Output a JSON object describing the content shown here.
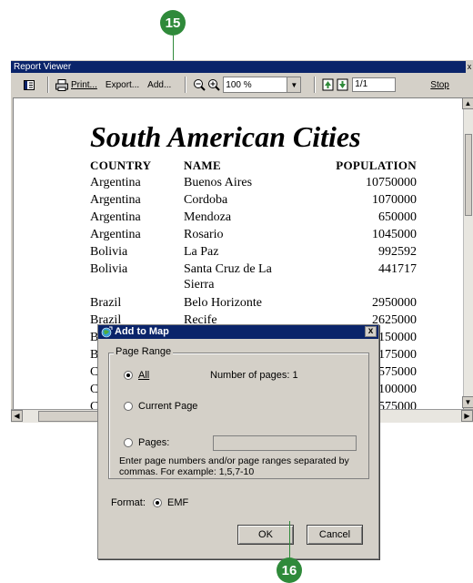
{
  "callouts": {
    "top": "15",
    "bottom": "16"
  },
  "window": {
    "title": "Report Viewer",
    "close_glyph": "x"
  },
  "toolbar": {
    "print_label": "Print...",
    "export_label": "Export...",
    "add_label": "Add...",
    "zoom_value": "100 %",
    "page_value": "1/1",
    "stop_label": "Stop"
  },
  "icons": {
    "toc": "table-of-contents-icon",
    "printer": "printer-icon",
    "zoom_out": "zoom-out-icon",
    "zoom_in": "zoom-in-icon",
    "page_up": "previous-page-icon",
    "page_down": "next-page-icon"
  },
  "report": {
    "title": "South American Cities",
    "columns": [
      "COUNTRY",
      "NAME",
      "POPULATION"
    ],
    "rows": [
      [
        "Argentina",
        "Buenos Aires",
        "10750000"
      ],
      [
        "Argentina",
        "Cordoba",
        "1070000"
      ],
      [
        "Argentina",
        "Mendoza",
        "650000"
      ],
      [
        "Argentina",
        "Rosario",
        "1045000"
      ],
      [
        "Bolivia",
        "La Paz",
        "992592"
      ],
      [
        "Bolivia",
        "Santa Cruz de La Sierra",
        "441717"
      ],
      [
        "Brazil",
        "Belo Horizonte",
        "2950000"
      ],
      [
        "Brazil",
        "Recife",
        "2625000"
      ],
      [
        "B",
        "",
        "150000"
      ],
      [
        "B",
        "",
        "175000"
      ],
      [
        "C",
        "",
        "575000"
      ],
      [
        "C",
        "",
        "100000"
      ],
      [
        "C",
        "",
        "575000"
      ]
    ]
  },
  "dialog": {
    "title": "Add to Map",
    "close_glyph": "x",
    "group_label": "Page Range",
    "radio_all": "All",
    "pages_count": "Number of pages:  1",
    "radio_current": "Current Page",
    "radio_pages": "Pages:",
    "help_text": "Enter page numbers and/or page ranges separated by commas. For example: 1,5,7-10",
    "format_label": "Format:",
    "format_value": "EMF",
    "ok_label": "OK",
    "cancel_label": "Cancel"
  },
  "colors": {
    "titlebar": "#0a246a",
    "callout": "#2f8a3a",
    "face": "#d4d0c8"
  }
}
